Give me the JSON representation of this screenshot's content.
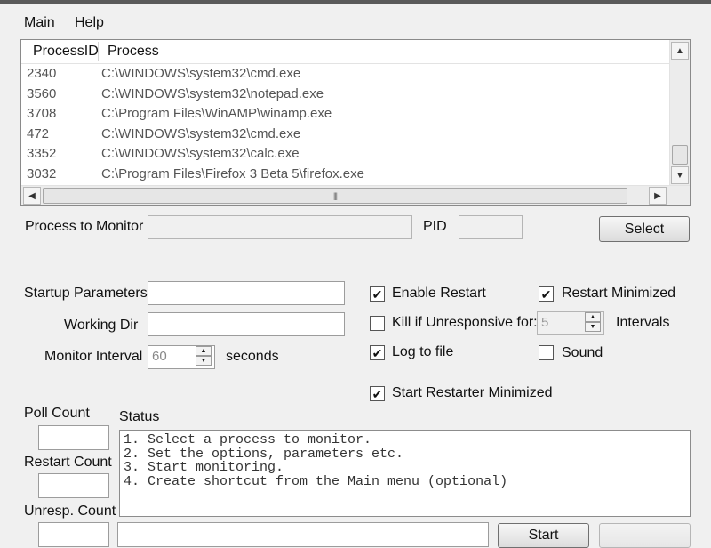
{
  "menu": {
    "main": "Main",
    "help": "Help"
  },
  "process_list": {
    "columns": [
      "ProcessID",
      "Process"
    ],
    "rows": [
      {
        "pid": "2340",
        "path": "C:\\WINDOWS\\system32\\cmd.exe"
      },
      {
        "pid": "3560",
        "path": "C:\\WINDOWS\\system32\\notepad.exe"
      },
      {
        "pid": "3708",
        "path": "C:\\Program Files\\WinAMP\\winamp.exe"
      },
      {
        "pid": "472",
        "path": "C:\\WINDOWS\\system32\\cmd.exe"
      },
      {
        "pid": "3352",
        "path": "C:\\WINDOWS\\system32\\calc.exe"
      },
      {
        "pid": "3032",
        "path": "C:\\Program Files\\Firefox 3 Beta 5\\firefox.exe"
      }
    ]
  },
  "monitor": {
    "process_label": "Process to Monitor",
    "process_value": "",
    "pid_label": "PID",
    "pid_value": "",
    "select_button": "Select"
  },
  "options": {
    "startup_params_label": "Startup Parameters",
    "startup_params_value": "",
    "working_dir_label": "Working Dir",
    "working_dir_value": "",
    "monitor_interval_label": "Monitor Interval",
    "monitor_interval_value": "60",
    "seconds_label": "seconds",
    "enable_restart": {
      "label": "Enable Restart",
      "checked": true
    },
    "restart_minimized": {
      "label": "Restart Minimized",
      "checked": true
    },
    "kill_unresponsive": {
      "label": "Kill if Unresponsive for:",
      "checked": false,
      "value": "5",
      "units": "Intervals"
    },
    "log_to_file": {
      "label": "Log to file",
      "checked": true
    },
    "sound": {
      "label": "Sound",
      "checked": false
    },
    "start_minimized": {
      "label": "Start Restarter Minimized",
      "checked": true
    }
  },
  "counts": {
    "poll_label": "Poll Count",
    "poll_value": "",
    "restart_label": "Restart Count",
    "restart_value": "",
    "unresp_label": "Unresp. Count",
    "unresp_value": ""
  },
  "status": {
    "label": "Status",
    "lines": [
      "1. Select a process to monitor.",
      "2. Set the options, parameters etc.",
      "3. Start monitoring.",
      "4. Create shortcut from the Main menu (optional)"
    ]
  },
  "bottom": {
    "start_button": "Start"
  },
  "icons": {
    "check": "✔",
    "up": "▲",
    "down": "▼",
    "left": "◀",
    "right": "▶",
    "grip": "|||"
  }
}
